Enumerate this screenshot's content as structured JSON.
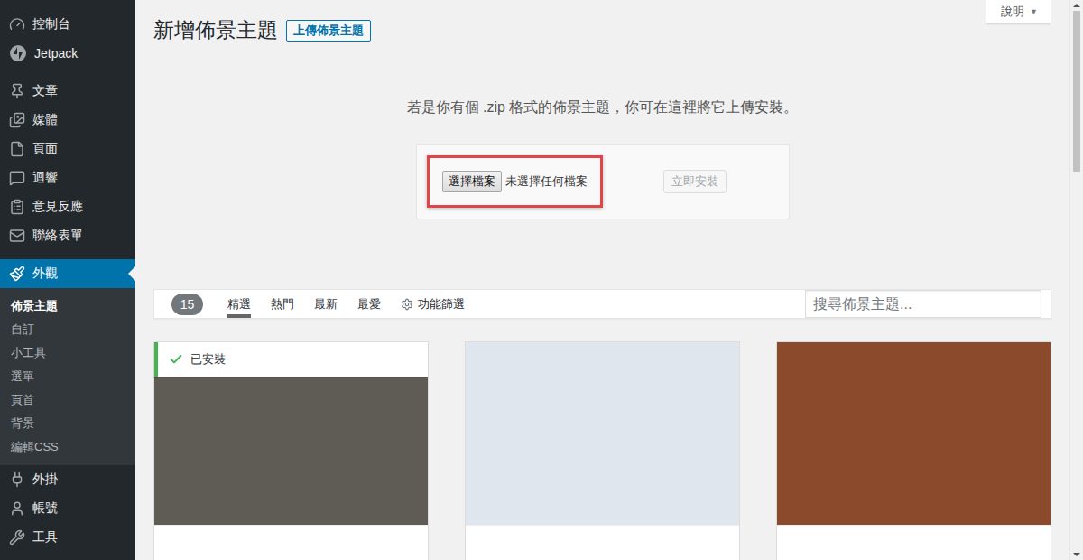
{
  "page": {
    "title": "新增佈景主題",
    "upload_button": "上傳佈景主題",
    "help_tab": {
      "label": "說明",
      "arrow": "▼"
    }
  },
  "sidebar": {
    "groups": [
      {
        "items": [
          {
            "label": "控制台",
            "selected": false,
            "expanded": false
          },
          {
            "label": "Jetpack",
            "selected": false,
            "expanded": false
          }
        ]
      },
      {
        "items": [
          {
            "label": "文章",
            "selected": false,
            "expanded": false
          },
          {
            "label": "媒體",
            "selected": false,
            "expanded": false
          },
          {
            "label": "頁面",
            "selected": false,
            "expanded": false
          },
          {
            "label": "迴響",
            "selected": false,
            "expanded": false
          },
          {
            "label": "意見反應",
            "selected": false,
            "expanded": false
          },
          {
            "label": "聯絡表單",
            "selected": false,
            "expanded": false
          }
        ]
      },
      {
        "items": [
          {
            "label": "外觀",
            "selected": true,
            "expanded": true,
            "submenu": [
              {
                "label": "佈景主題",
                "selected": true
              },
              {
                "label": "自訂",
                "selected": false
              },
              {
                "label": "小工具",
                "selected": false
              },
              {
                "label": "選單",
                "selected": false
              },
              {
                "label": "頁首",
                "selected": false
              },
              {
                "label": "背景",
                "selected": false
              },
              {
                "label": "編輯CSS",
                "selected": false
              }
            ]
          },
          {
            "label": "外掛",
            "selected": false,
            "expanded": false
          },
          {
            "label": "帳號",
            "selected": false,
            "expanded": false
          },
          {
            "label": "工具",
            "selected": false,
            "expanded": false
          }
        ]
      }
    ]
  },
  "upload": {
    "instructions": "若是你有個 .zip 格式的佈景主題，你可在這裡將它上傳安裝。",
    "file_input": {
      "button": "選擇檔案",
      "status": "未選擇任何檔案",
      "highlighted": true
    },
    "install_button": {
      "label": "立即安裝",
      "disabled": true
    }
  },
  "filter_bar": {
    "count": "15",
    "tabs": [
      {
        "label": "精選",
        "selected": true,
        "kind": "tab"
      },
      {
        "label": "熱門",
        "selected": false,
        "kind": "tab"
      },
      {
        "label": "最新",
        "selected": false,
        "kind": "tab"
      },
      {
        "label": "最愛",
        "selected": false,
        "kind": "tab"
      },
      {
        "label": "功能篩選",
        "selected": false,
        "kind": "filter"
      }
    ],
    "search": {
      "placeholder": "搜尋佈景主題..."
    }
  },
  "themes": [
    {
      "installed": true,
      "installed_label": "已安裝",
      "color": "#5f5b55"
    },
    {
      "installed": false,
      "color": "#dfe6ed"
    },
    {
      "installed": false,
      "color": "#8a4a2b"
    }
  ]
}
